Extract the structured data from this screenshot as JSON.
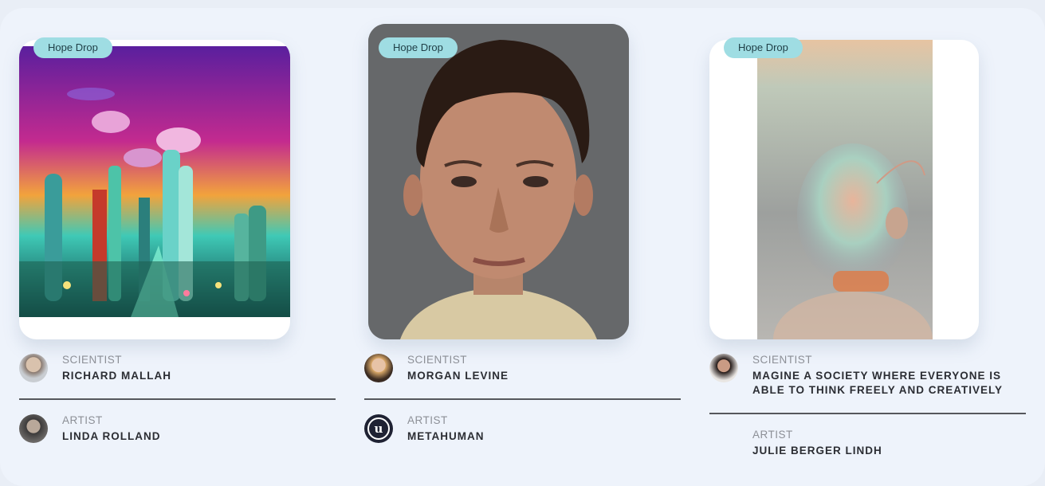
{
  "cards": [
    {
      "badge": "Hope Drop",
      "scientist": {
        "role": "SCIENTIST",
        "name": "RICHARD MALLAH"
      },
      "artist": {
        "role": "ARTIST",
        "name": "LINDA ROLLAND"
      }
    },
    {
      "badge": "Hope Drop",
      "scientist": {
        "role": "SCIENTIST",
        "name": "MORGAN LEVINE"
      },
      "artist": {
        "role": "ARTIST",
        "name": "METAHUMAN"
      }
    },
    {
      "badge": "Hope Drop",
      "scientist": {
        "role": "SCIENTIST",
        "name": "MAGINE A SOCIETY WHERE EVERYONE IS ABLE TO THINK FREELY AND CREATIVELY"
      },
      "artist": {
        "role": "ARTIST",
        "name": "JULIE BERGER LINDH"
      }
    }
  ],
  "colors": {
    "badge": "#9fdde3",
    "panel": "#eef3fb",
    "rule": "#55575c"
  }
}
